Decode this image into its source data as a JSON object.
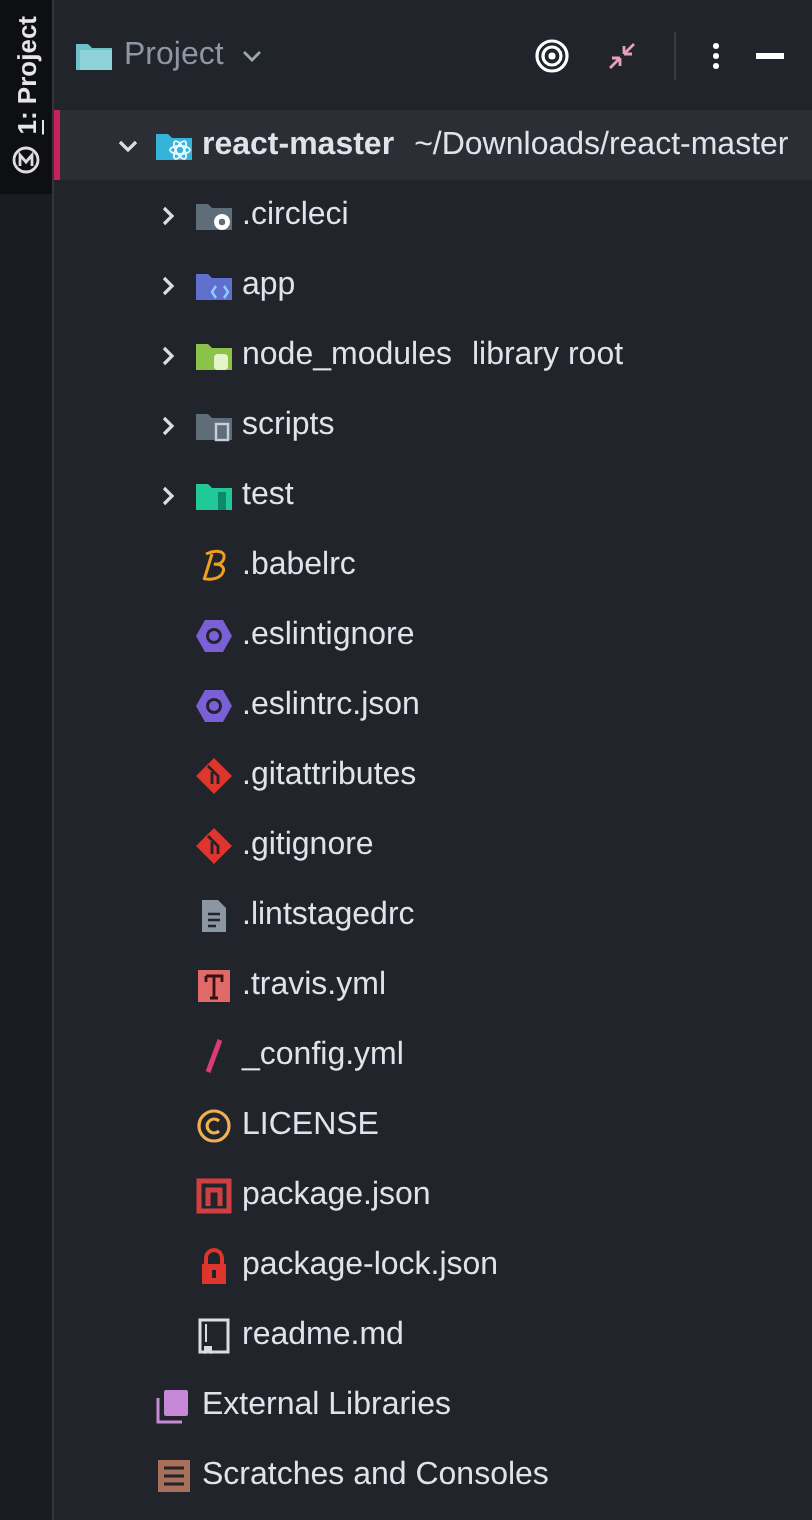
{
  "side_tab": {
    "mnemonic": "1",
    "label": ": Project",
    "selected": true
  },
  "header": {
    "title": "Project"
  },
  "tree": [
    {
      "name": "react-master",
      "detail": "~/Downloads/react-master",
      "kind": "project",
      "expanded": true,
      "selected": true,
      "children": [
        {
          "name": ".circleci",
          "kind": "folder-ci",
          "expanded": false
        },
        {
          "name": "app",
          "kind": "folder-src",
          "expanded": false
        },
        {
          "name": "node_modules",
          "detail": "library root",
          "kind": "folder-lib",
          "expanded": false
        },
        {
          "name": "scripts",
          "kind": "folder-scripts",
          "expanded": false
        },
        {
          "name": "test",
          "kind": "folder-test",
          "expanded": false
        },
        {
          "name": ".babelrc",
          "kind": "babel"
        },
        {
          "name": ".eslintignore",
          "kind": "eslint"
        },
        {
          "name": ".eslintrc.json",
          "kind": "eslint"
        },
        {
          "name": ".gitattributes",
          "kind": "git"
        },
        {
          "name": ".gitignore",
          "kind": "git"
        },
        {
          "name": ".lintstagedrc",
          "kind": "text"
        },
        {
          "name": ".travis.yml",
          "kind": "travis"
        },
        {
          "name": "_config.yml",
          "kind": "yml"
        },
        {
          "name": "LICENSE",
          "kind": "license"
        },
        {
          "name": "package.json",
          "kind": "npm"
        },
        {
          "name": "package-lock.json",
          "kind": "lock"
        },
        {
          "name": "readme.md",
          "kind": "readme"
        }
      ]
    },
    {
      "name": "External Libraries",
      "kind": "libraries"
    },
    {
      "name": "Scratches and Consoles",
      "kind": "scratches"
    }
  ]
}
